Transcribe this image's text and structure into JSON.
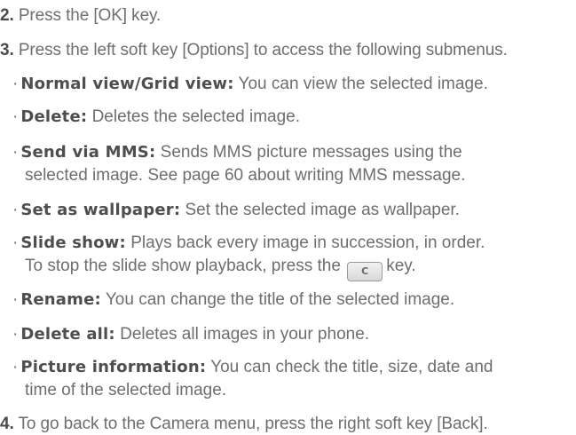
{
  "steps": {
    "s2": {
      "num": "2.",
      "text": "Press the [OK] key."
    },
    "s3": {
      "num": "3.",
      "text": "Press the left soft key [Options] to access the following submenus."
    },
    "s4": {
      "num": "4.",
      "text": "To go back to the Camera menu, press the right soft key [Back]."
    }
  },
  "bullet_char": "·",
  "items": [
    {
      "term": "Normal view/Grid view:",
      "line1": "You can view the selected image."
    },
    {
      "term": "Delete:",
      "line1": "Deletes the selected image."
    },
    {
      "term": "Send via MMS:",
      "line1": "Sends MMS picture messages using the",
      "line2": "selected image. See page 60 about writing MMS message."
    },
    {
      "term": "Set as wallpaper:",
      "line1": "Set the selected image as wallpaper."
    },
    {
      "term": "Slide show:",
      "line1": "Plays back every image in succession, in order.",
      "line2a": "To stop the slide show playback, press the",
      "key_label": "C",
      "line2b": "key."
    },
    {
      "term": "Rename:",
      "line1": "You can change the title of the selected image."
    },
    {
      "term": "Delete all:",
      "line1": "Deletes all images in your phone."
    },
    {
      "term": "Picture information:",
      "line1": "You can check the title, size, date and",
      "line2": "time of the selected image."
    }
  ]
}
